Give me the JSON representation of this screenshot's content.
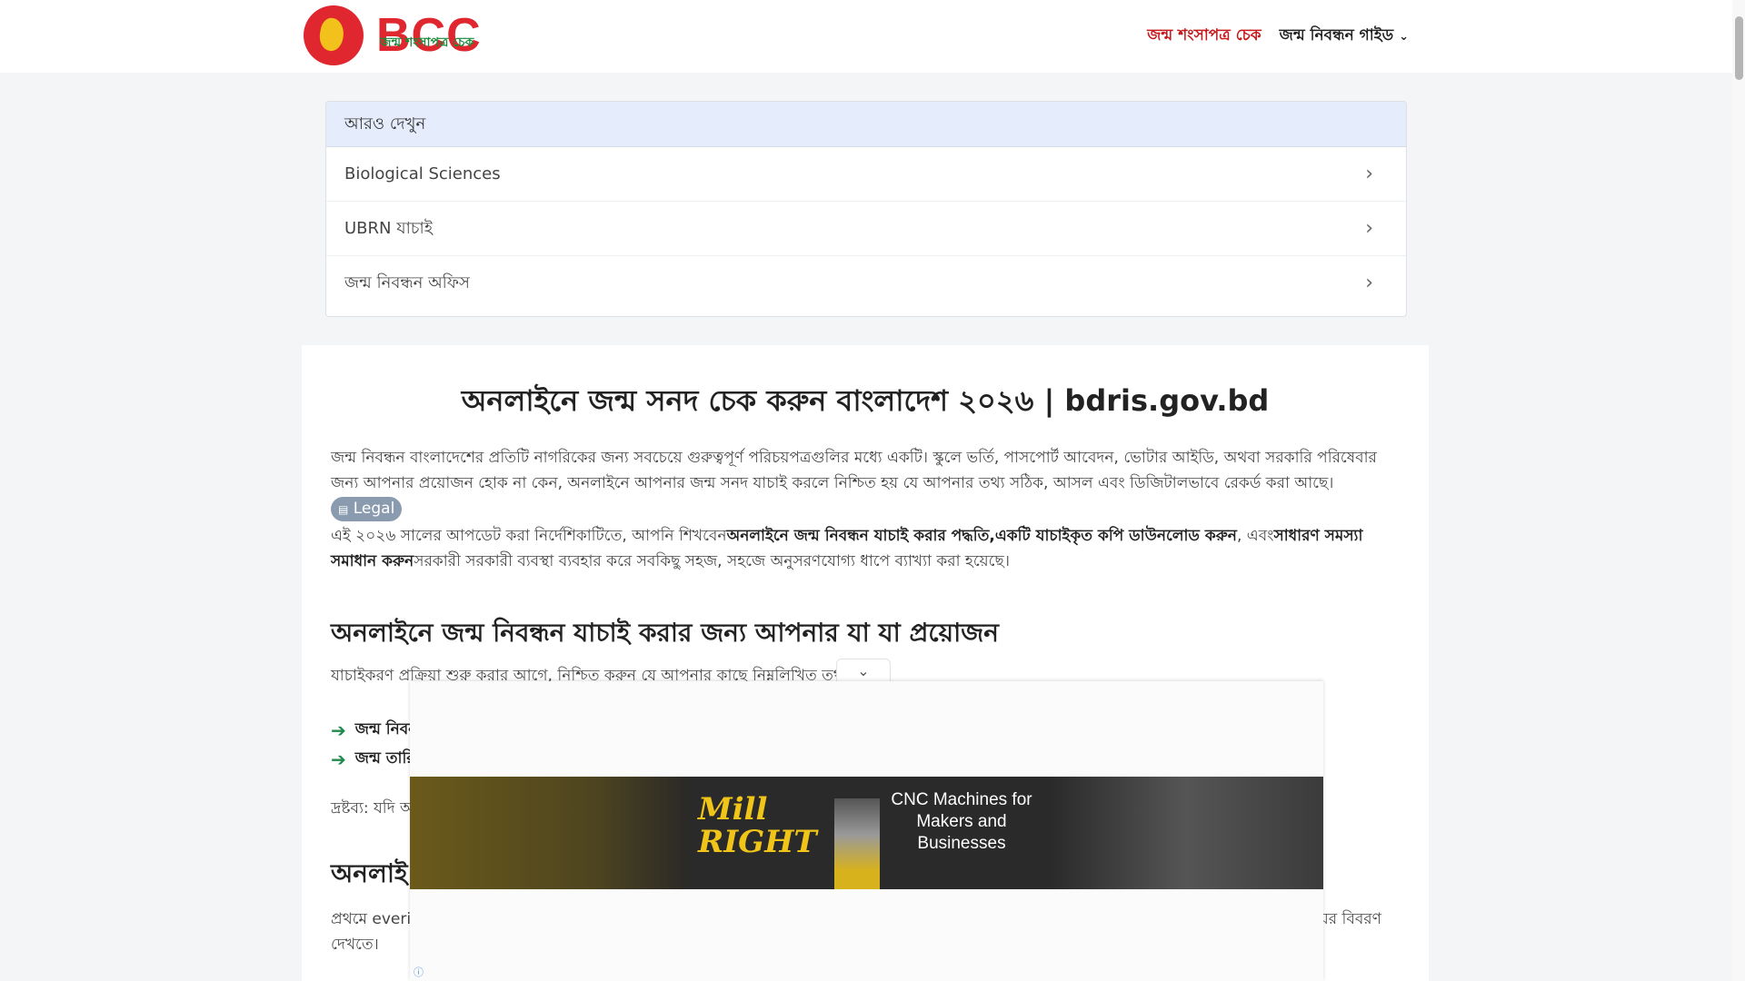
{
  "header": {
    "logo_text": "BCC",
    "logo_sub": "জন্ম শংসাপত্র চেক",
    "nav_active": "জন্ম শংসাপত্র চেক",
    "nav_guide": "জন্ম নিবন্ধন গাইড",
    "nav_guide_chevron": "⌄"
  },
  "see_also": {
    "heading": "আরও দেখুন",
    "items": [
      {
        "label": "Biological Sciences"
      },
      {
        "label": "UBRN যাচাই"
      },
      {
        "label": "জন্ম নিবন্ধন অফিস"
      }
    ],
    "arrow": "›"
  },
  "article": {
    "title": "অনলাইনে জন্ম সনদ চেক করুন বাংলাদেশ ২০২৬ | bdris.gov.bd",
    "p1": "জন্ম নিবন্ধন বাংলাদেশের প্রতিটি নাগরিকের জন্য সবচেয়ে গুরুত্বপূর্ণ পরিচয়পত্রগুলির মধ্যে একটি। স্কুলে ভর্তি, পাসপোর্ট আবেদন, ভোটার আইডি, অথবা সরকারি পরিষেবার জন্য আপনার প্রয়োজন হোক না কেন, অনলাইনে আপনার জন্ম সনদ যাচাই করলে নিশ্চিত হয় যে আপনার তথ্য সঠিক, আসল এবং ডিজিটালভাবে রেকর্ড করা আছে।",
    "legal_icon": "▤",
    "legal_label": "Legal",
    "p2_a": "এই ২০২৬ সালের আপডেট করা নির্দেশিকাটিতে, আপনি শিখবেন",
    "p2_b": "অনলাইনে জন্ম নিবন্ধন যাচাই করার পদ্ধতি",
    "p2_c": ",",
    "p2_d": "একটি যাচাইকৃত কপি ডাউনলোড করুন",
    "p2_e": ", এবং",
    "p2_f": "সাধারণ সমস্যা সমাধান করুন",
    "p2_g": "সরকারী সরকারী ব্যবস্থা ব্যবহার করে সবকিছু সহজ, সহজে অনুসরণযোগ্য ধাপে ব্যাখ্যা করা হয়েছে।",
    "h2": "অনলাইনে জন্ম নিবন্ধন যাচাই করার জন্য আপনার যা যা প্রয়োজন",
    "p3": "যাচাইকরণ প্রক্রিয়া শুরু করার আগে, নিশ্চিত করুন যে আপনার কাছে নিম্নলিখিত তথ",
    "list": [
      {
        "arrow": "➔",
        "label": "জন্ম নিবন"
      },
      {
        "arrow": "➔",
        "label": "জন্ম তারি"
      }
    ],
    "note": "দ্রষ্টব্য: যদি অ",
    "h2b": "অনলাই",
    "p4": "প্রথমে everi",
    "p4_right": "ন্মের বিবরণ",
    "p4_line2": "দেখতে।"
  },
  "ad": {
    "toggle": "⌄",
    "brand_line1": "Mill",
    "brand_line2": "RIGHT",
    "copy": "CNC Machines for Makers and Businesses",
    "info_icon": "ⓘ"
  }
}
